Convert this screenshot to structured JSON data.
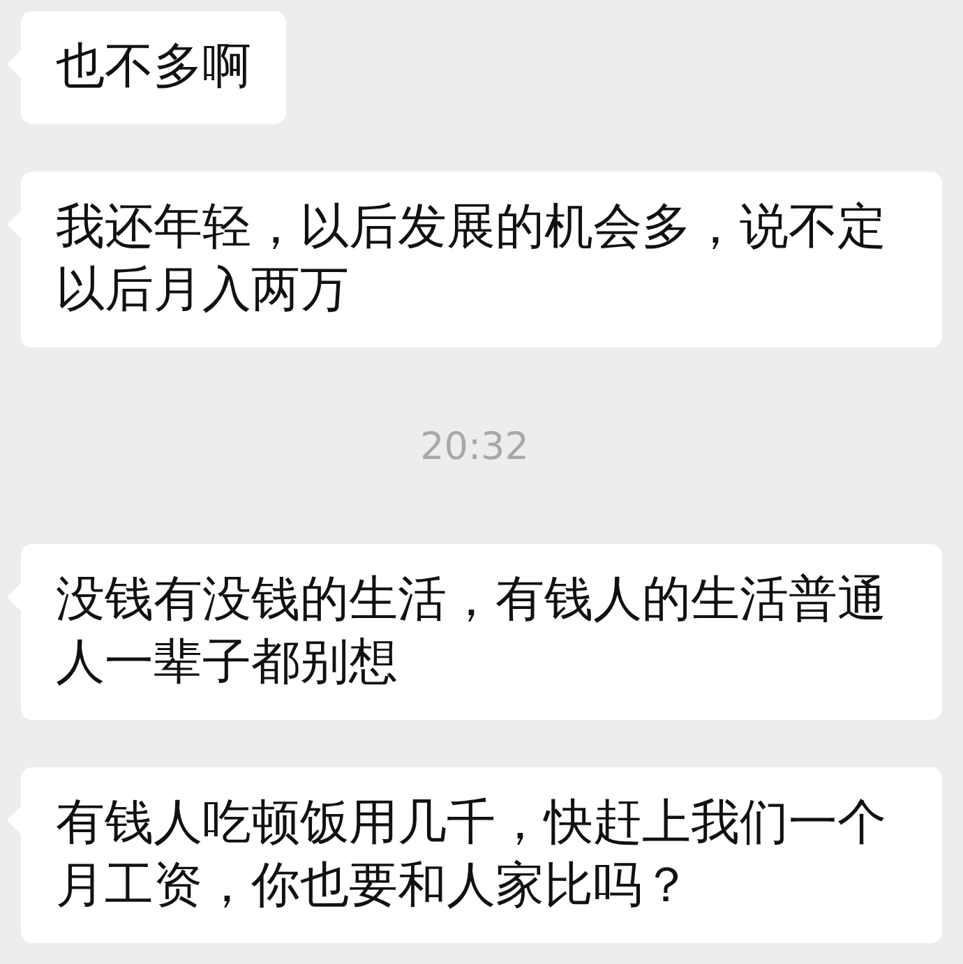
{
  "messages": [
    {
      "kind": "message",
      "text": "也不多啊"
    },
    {
      "kind": "message",
      "text": "我还年轻，以后发展的机会多，说不定以后月入两万"
    },
    {
      "kind": "time",
      "text": "20:32"
    },
    {
      "kind": "message",
      "text": "没钱有没钱的生活，有钱人的生活普通人一辈子都别想"
    },
    {
      "kind": "message",
      "text": "有钱人吃顿饭用几千，快赶上我们一个月工资，你也要和人家比吗？"
    }
  ]
}
